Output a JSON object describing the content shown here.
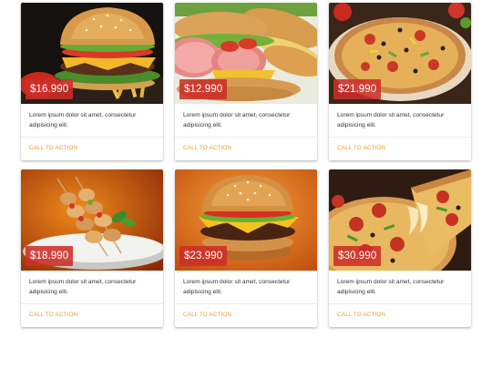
{
  "cards": [
    {
      "price": "$16.990",
      "description": "Lorem ipsum dolor sit amet, consectetur adipisicing elit.",
      "cta": "CALL TO ACTION",
      "image": "burger-with-fries-image"
    },
    {
      "price": "$12.990",
      "description": "Lorem ipsum dolor sit amet, consectetur adipisicing elit.",
      "cta": "CALL TO ACTION",
      "image": "ham-sandwich-image"
    },
    {
      "price": "$21.990",
      "description": "Lorem ipsum dolor sit amet, consectetur adipisicing elit.",
      "cta": "CALL TO ACTION",
      "image": "pizza-image"
    },
    {
      "price": "$18.990",
      "description": "Lorem ipsum dolor sit amet, consectetur adipisicing elit.",
      "cta": "CALL TO ACTION",
      "image": "chicken-skewers-image"
    },
    {
      "price": "$23.990",
      "description": "Lorem ipsum dolor sit amet, consectetur adipisicing elit.",
      "cta": "CALL TO ACTION",
      "image": "cheeseburger-image"
    },
    {
      "price": "$30.990",
      "description": "Lorem ipsum dolor sit amet, consectetur adipisicing elit.",
      "cta": "CALL TO ACTION",
      "image": "pizza-slice-image"
    }
  ],
  "colors": {
    "price_badge": "#cd2d28",
    "cta": "#f0a030",
    "text": "#333333"
  }
}
